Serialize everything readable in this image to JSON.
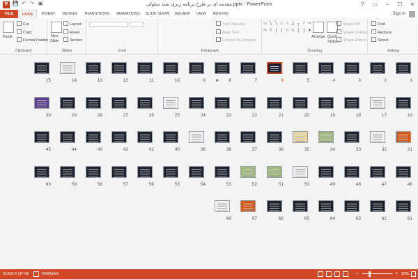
{
  "app": {
    "window_title": "ﻣﻘﺪﻣﻪ ای ﺑﺮ ﻃﺮح ﺑﺮﻧﺎﻣﻪ رﯾﺰی ﻧﺴﺪ ﺳﻠﻮﻟﯽ.pptx - PowerPoint",
    "app_icon_letter": "P",
    "qat": [
      "💾",
      "↶",
      "↷",
      "▣"
    ],
    "window_controls": [
      "?",
      "▭",
      "–",
      "☐",
      "✕"
    ]
  },
  "tabs": [
    {
      "label": "FILE"
    },
    {
      "label": "HOME"
    },
    {
      "label": "INSERT"
    },
    {
      "label": "DESIGN"
    },
    {
      "label": "TRANSITIONS"
    },
    {
      "label": "ANIMATIONS"
    },
    {
      "label": "SLIDE SHOW"
    },
    {
      "label": "REVIEW"
    },
    {
      "label": "VIEW"
    },
    {
      "label": "ADD-INS"
    }
  ],
  "signin": "Sign in",
  "ribbon": {
    "clipboard": {
      "label": "Clipboard",
      "paste": "Paste",
      "cut": "Cut",
      "copy": "Copy",
      "format_painter": "Format Painter"
    },
    "slides": {
      "label": "Slides",
      "new_slide": "New",
      "new_slide_2": "Slide",
      "layout": "Layout",
      "reset": "Reset",
      "section": "Section"
    },
    "font": {
      "label": "Font"
    },
    "paragraph": {
      "label": "Paragraph",
      "text_direction": "Text Direction",
      "align_text": "Align Text",
      "convert_smartart": "Convert to SmartArt"
    },
    "drawing": {
      "label": "Drawing",
      "arrange": "Arrange",
      "quick_styles": "Quick",
      "quick_styles_2": "Styles",
      "shape_fill": "Shape Fill",
      "shape_outline": "Shape Outline",
      "shape_effects": "Shape Effects"
    },
    "editing": {
      "label": "Editing",
      "find": "Find",
      "replace": "Replace",
      "select": "Select"
    }
  },
  "slides": [
    {
      "number": "1",
      "row": 0,
      "col": 0,
      "style": "dark"
    },
    {
      "number": "2",
      "row": 0,
      "col": 1,
      "style": "dark"
    },
    {
      "number": "3",
      "row": 0,
      "col": 2,
      "style": "dark"
    },
    {
      "number": "4",
      "row": 0,
      "col": 3,
      "style": "dark"
    },
    {
      "number": "5",
      "row": 0,
      "col": 4,
      "style": "dark"
    },
    {
      "number": "6",
      "row": 0,
      "col": 5,
      "style": "dark",
      "selected": true
    },
    {
      "number": "7",
      "row": 0,
      "col": 6,
      "style": "dark"
    },
    {
      "number": "8",
      "row": 0,
      "col": 7,
      "style": "dark",
      "star": true
    },
    {
      "number": "9",
      "row": 0,
      "col": 8,
      "style": "dark"
    },
    {
      "number": "10",
      "row": 0,
      "col": 9,
      "style": "dark"
    },
    {
      "number": "11",
      "row": 0,
      "col": 10,
      "style": "dark"
    },
    {
      "number": "12",
      "row": 0,
      "col": 11,
      "style": "dark"
    },
    {
      "number": "13",
      "row": 0,
      "col": 12,
      "style": "dark"
    },
    {
      "number": "14",
      "row": 0,
      "col": 13,
      "style": "light"
    },
    {
      "number": "15",
      "row": 0,
      "col": 14,
      "style": "dark"
    },
    {
      "number": "16",
      "row": 1,
      "col": 0,
      "style": "dark"
    },
    {
      "number": "17",
      "row": 1,
      "col": 1,
      "style": "light"
    },
    {
      "number": "18",
      "row": 1,
      "col": 2,
      "style": "dark"
    },
    {
      "number": "19",
      "row": 1,
      "col": 3,
      "style": "dark"
    },
    {
      "number": "20",
      "row": 1,
      "col": 4,
      "style": "dark"
    },
    {
      "number": "21",
      "row": 1,
      "col": 5,
      "style": "dark"
    },
    {
      "number": "22",
      "row": 1,
      "col": 6,
      "style": "dark"
    },
    {
      "number": "23",
      "row": 1,
      "col": 7,
      "style": "dark"
    },
    {
      "number": "24",
      "row": 1,
      "col": 8,
      "style": "dark"
    },
    {
      "number": "25",
      "row": 1,
      "col": 9,
      "style": "light"
    },
    {
      "number": "26",
      "row": 1,
      "col": 10,
      "style": "dark"
    },
    {
      "number": "27",
      "row": 1,
      "col": 11,
      "style": "dark"
    },
    {
      "number": "28",
      "row": 1,
      "col": 12,
      "style": "dark"
    },
    {
      "number": "29",
      "row": 1,
      "col": 13,
      "style": "dark"
    },
    {
      "number": "30",
      "row": 1,
      "col": 14,
      "style": "purple"
    },
    {
      "number": "31",
      "row": 2,
      "col": 0,
      "style": "orange"
    },
    {
      "number": "32",
      "row": 2,
      "col": 1,
      "style": "light"
    },
    {
      "number": "33",
      "row": 2,
      "col": 2,
      "style": "dark"
    },
    {
      "number": "34",
      "row": 2,
      "col": 3,
      "style": "green"
    },
    {
      "number": "35",
      "row": 2,
      "col": 4,
      "style": "yellow"
    },
    {
      "number": "36",
      "row": 2,
      "col": 5,
      "style": "dark"
    },
    {
      "number": "37",
      "row": 2,
      "col": 6,
      "style": "dark"
    },
    {
      "number": "38",
      "row": 2,
      "col": 7,
      "style": "dark"
    },
    {
      "number": "39",
      "row": 2,
      "col": 8,
      "style": "light"
    },
    {
      "number": "40",
      "row": 2,
      "col": 9,
      "style": "dark"
    },
    {
      "number": "41",
      "row": 2,
      "col": 10,
      "style": "dark"
    },
    {
      "number": "42",
      "row": 2,
      "col": 11,
      "style": "dark"
    },
    {
      "number": "43",
      "row": 2,
      "col": 12,
      "style": "dark"
    },
    {
      "number": "44",
      "row": 2,
      "col": 13,
      "style": "dark"
    },
    {
      "number": "45",
      "row": 2,
      "col": 14,
      "style": "dark"
    },
    {
      "number": "46",
      "row": 3,
      "col": 0,
      "style": "dark"
    },
    {
      "number": "47",
      "row": 3,
      "col": 1,
      "style": "dark"
    },
    {
      "number": "48",
      "row": 3,
      "col": 2,
      "style": "dark"
    },
    {
      "number": "49",
      "row": 3,
      "col": 3,
      "style": "dark"
    },
    {
      "number": "50",
      "row": 3,
      "col": 4,
      "style": "light"
    },
    {
      "number": "51",
      "row": 3,
      "col": 5,
      "style": "green"
    },
    {
      "number": "52",
      "row": 3,
      "col": 6,
      "style": "green"
    },
    {
      "number": "53",
      "row": 3,
      "col": 7,
      "style": "dark"
    },
    {
      "number": "54",
      "row": 3,
      "col": 8,
      "style": "dark"
    },
    {
      "number": "55",
      "row": 3,
      "col": 9,
      "style": "dark"
    },
    {
      "number": "56",
      "row": 3,
      "col": 10,
      "style": "dark"
    },
    {
      "number": "57",
      "row": 3,
      "col": 11,
      "style": "dark"
    },
    {
      "number": "58",
      "row": 3,
      "col": 12,
      "style": "dark"
    },
    {
      "number": "59",
      "row": 3,
      "col": 13,
      "style": "dark"
    },
    {
      "number": "60",
      "row": 3,
      "col": 14,
      "style": "dark"
    },
    {
      "number": "61",
      "row": 4,
      "col": 0,
      "style": "dark"
    },
    {
      "number": "62",
      "row": 4,
      "col": 1,
      "style": "dark"
    },
    {
      "number": "63",
      "row": 4,
      "col": 2,
      "style": "dark"
    },
    {
      "number": "64",
      "row": 4,
      "col": 3,
      "style": "dark"
    },
    {
      "number": "65",
      "row": 4,
      "col": 4,
      "style": "dark"
    },
    {
      "number": "66",
      "row": 4,
      "col": 5,
      "style": "dark"
    },
    {
      "number": "67",
      "row": 4,
      "col": 6,
      "style": "orange"
    },
    {
      "number": "68",
      "row": 4,
      "col": 7,
      "style": "light"
    }
  ],
  "status": {
    "slide_info": "SLIDE 6 OF 68",
    "language": "PERSIAN",
    "zoom": "20%",
    "zoom_fraction": 0.2
  },
  "colors": {
    "accent": "#d24726",
    "selected_border": "#d24726"
  }
}
